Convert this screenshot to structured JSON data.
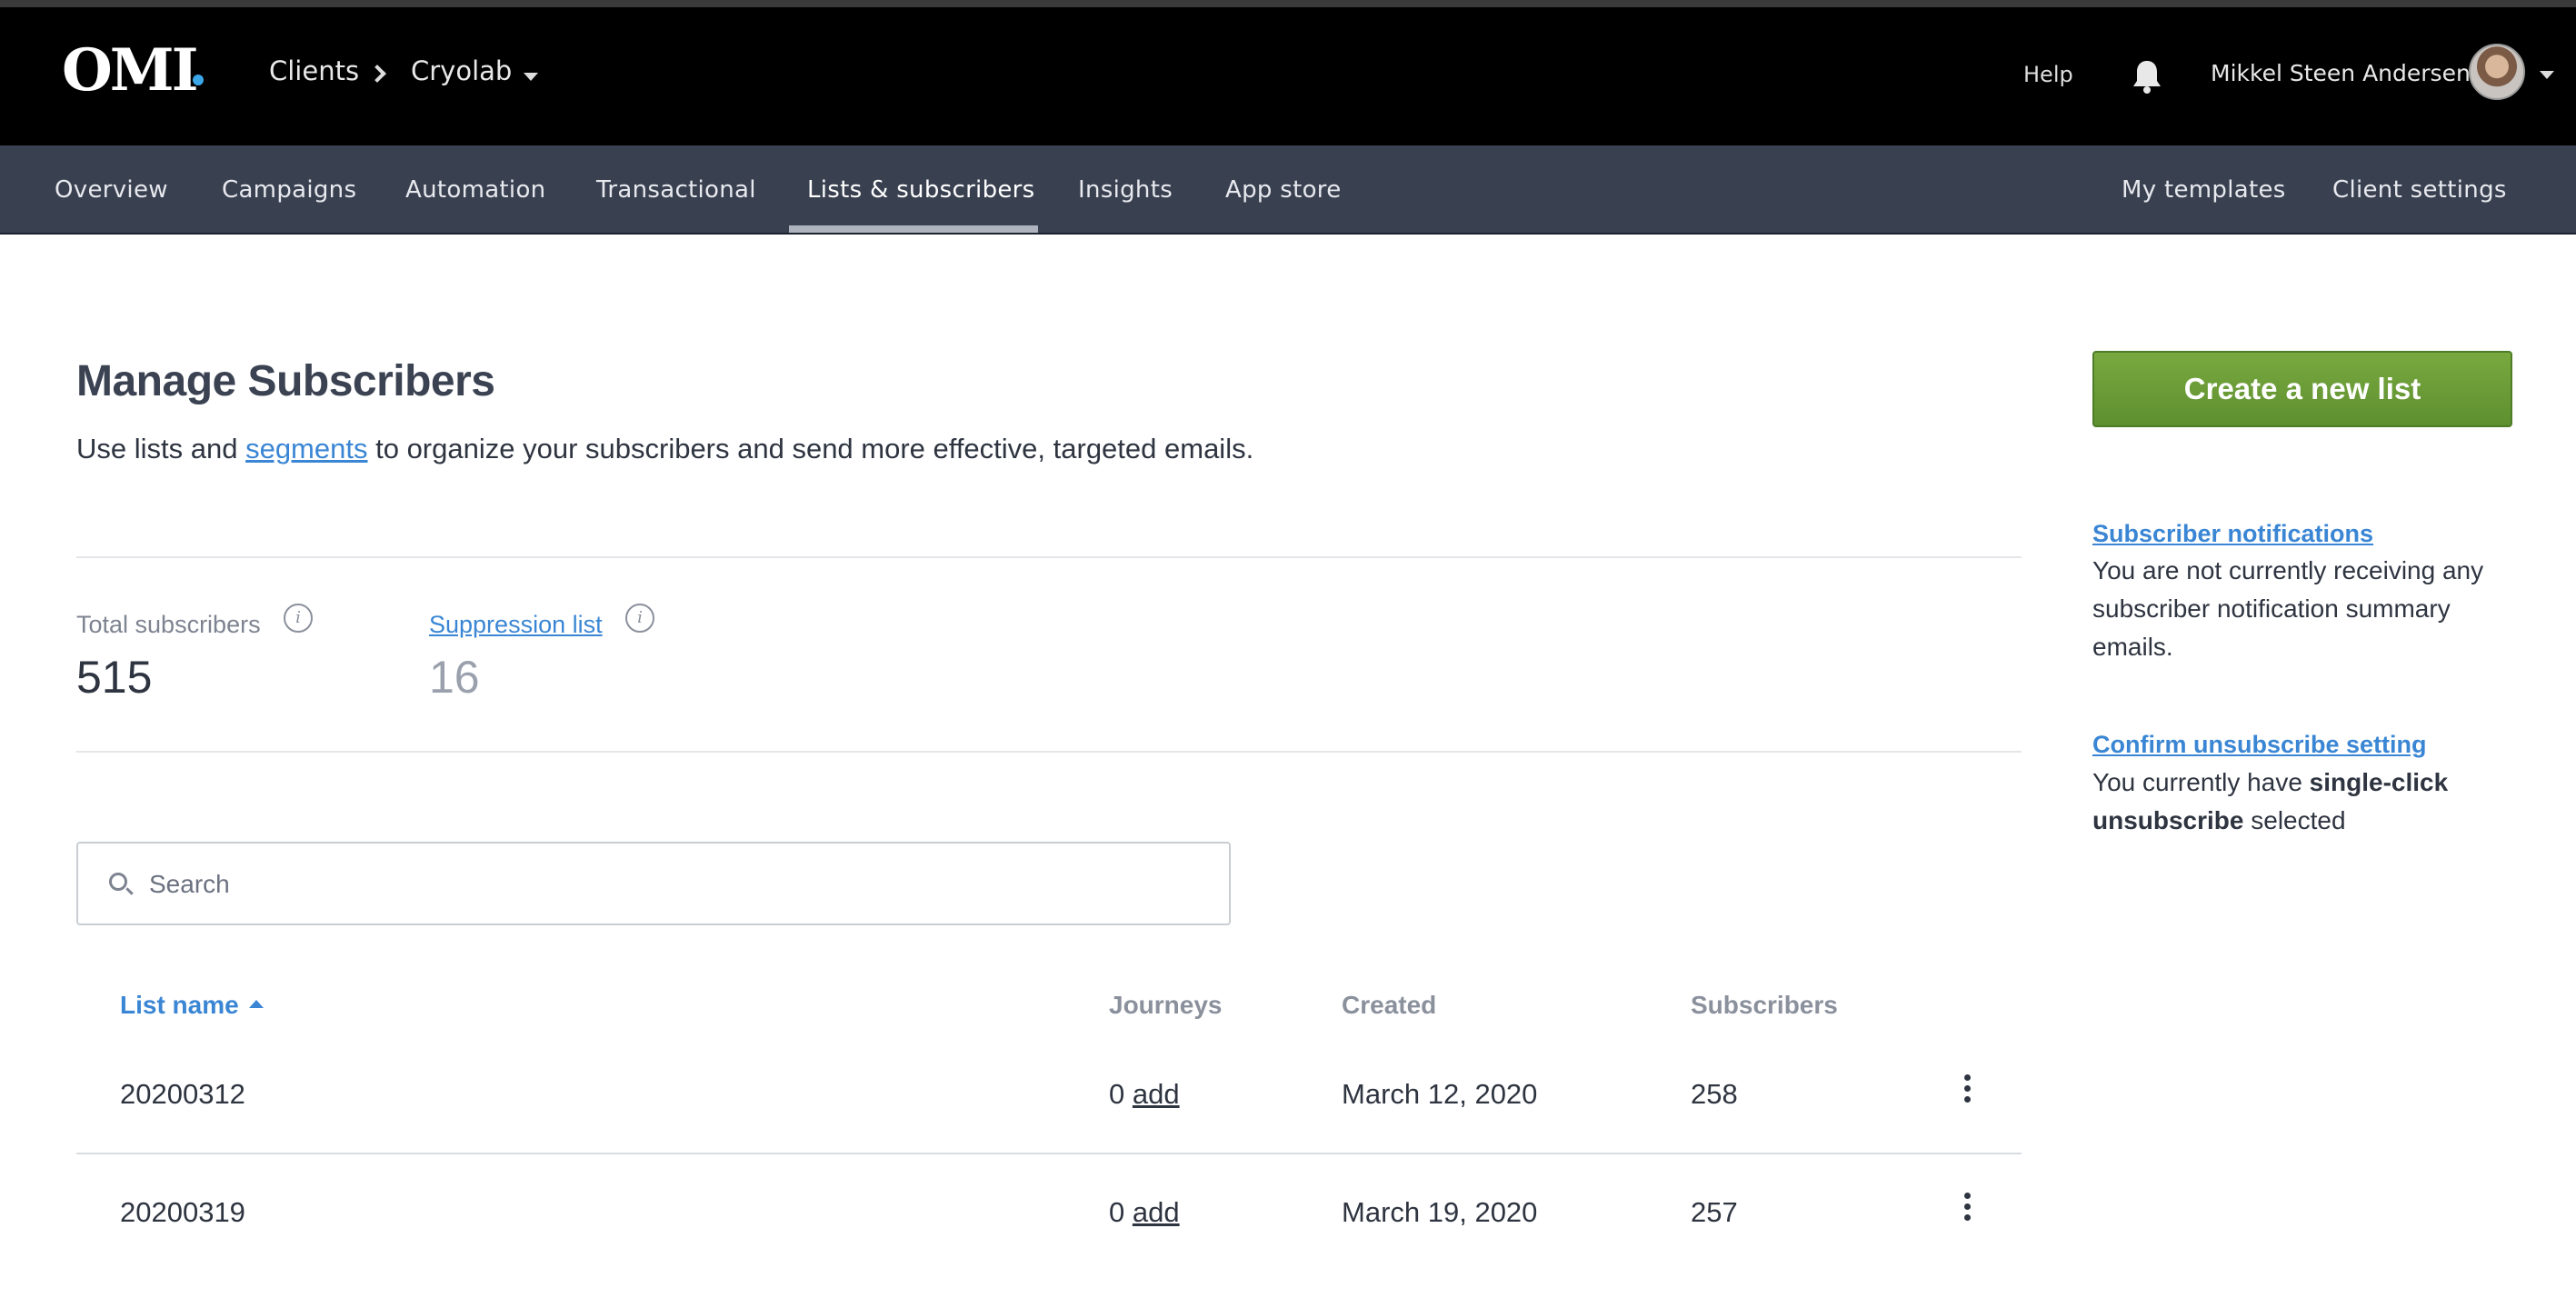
{
  "topbar": {
    "logo_text": "OMI",
    "breadcrumb": {
      "clients": "Clients",
      "current_client": "Cryolab"
    },
    "help": "Help",
    "user_name": "Mikkel Steen Andersen",
    "icons": {
      "breadcrumb_separator": "chevron-right-icon",
      "client_dropdown": "caret-down-icon",
      "notifications": "bell-icon",
      "user_menu": "caret-down-icon"
    }
  },
  "nav": {
    "items": [
      "Overview",
      "Campaigns",
      "Automation",
      "Transactional",
      "Lists & subscribers",
      "Insights",
      "App store"
    ],
    "active": "Lists & subscribers",
    "right_items": [
      "My templates",
      "Client settings"
    ]
  },
  "page": {
    "title": "Manage Subscribers",
    "subtitle_before": "Use lists and ",
    "subtitle_link": "segments",
    "subtitle_after": " to organize your subscribers and send more effective, targeted emails."
  },
  "stats": {
    "total_label": "Total subscribers",
    "total_value": "515",
    "suppression_label": "Suppression list",
    "suppression_value": "16"
  },
  "search": {
    "placeholder": "Search"
  },
  "table": {
    "headers": {
      "name": "List name",
      "journeys": "Journeys",
      "created": "Created",
      "subscribers": "Subscribers"
    },
    "sort": {
      "column": "List name",
      "direction": "ascending"
    },
    "rows": [
      {
        "name": "20200312",
        "journeys": "0",
        "journeys_link": "add",
        "created": "March 12, 2020",
        "subscribers": "258"
      },
      {
        "name": "20200319",
        "journeys": "0",
        "journeys_link": "add",
        "created": "March 19, 2020",
        "subscribers": "257"
      }
    ]
  },
  "sidebar": {
    "create_button": "Create a new list",
    "notifications_link": "Subscriber notifications",
    "notifications_text": "You are not currently receiving any subscriber notification summary emails.",
    "unsubscribe_link": "Confirm unsubscribe setting",
    "unsubscribe_text_before": "You currently have ",
    "unsubscribe_text_bold": "single-click unsubscribe",
    "unsubscribe_text_after": " selected"
  },
  "colors": {
    "topbar": "#000000",
    "navbar": "#394050",
    "link": "#3a86d4",
    "create_button": "#6a9c36"
  }
}
